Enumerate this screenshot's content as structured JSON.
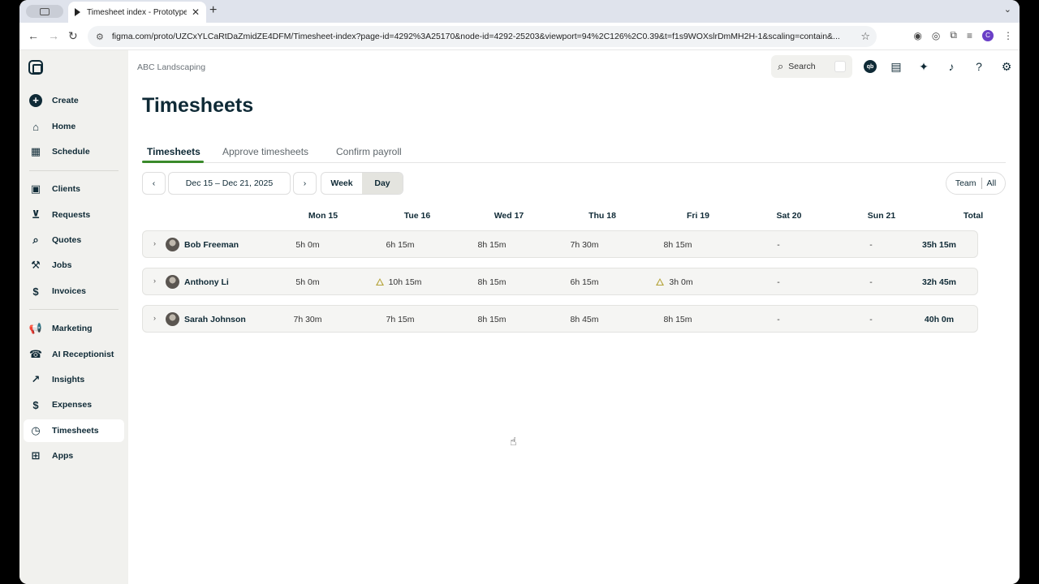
{
  "browser": {
    "tab_title": "Timesheet index - Prototype",
    "tab_close": "✕",
    "new_tab": "+",
    "url": "figma.com/proto/UZCxYLCaRtDaZmidZE4DFM/Timesheet-index?page-id=4292%3A25170&node-id=4292-25203&viewport=94%2C126%2C0.39&t=f1s9WOXslrDmMH2H-1&scaling=contain&...",
    "profile_initial": "C"
  },
  "sidebar": {
    "items": [
      {
        "label": "Create",
        "icon": "plus-circle-icon"
      },
      {
        "label": "Home",
        "icon": "home-icon"
      },
      {
        "label": "Schedule",
        "icon": "calendar-icon"
      },
      {
        "label": "Clients",
        "icon": "contacts-icon"
      },
      {
        "label": "Requests",
        "icon": "inbox-icon"
      },
      {
        "label": "Quotes",
        "icon": "quote-icon"
      },
      {
        "label": "Jobs",
        "icon": "hammer-icon"
      },
      {
        "label": "Invoices",
        "icon": "invoice-icon"
      },
      {
        "label": "Marketing",
        "icon": "megaphone-icon"
      },
      {
        "label": "AI Receptionist",
        "icon": "receptionist-icon"
      },
      {
        "label": "Insights",
        "icon": "chart-icon"
      },
      {
        "label": "Expenses",
        "icon": "expense-icon"
      },
      {
        "label": "Timesheets",
        "icon": "clock-icon"
      },
      {
        "label": "Apps",
        "icon": "apps-icon"
      }
    ],
    "active": "Timesheets"
  },
  "header": {
    "company": "ABC Landscaping",
    "search_label": "Search",
    "qb_label": "qb"
  },
  "page": {
    "title": "Timesheets",
    "tabs": [
      "Timesheets",
      "Approve timesheets",
      "Confirm payroll"
    ],
    "date_range": "Dec 15 – Dec 21, 2025",
    "view_week": "Week",
    "view_day": "Day",
    "team_label": "Team",
    "all_label": "All"
  },
  "table": {
    "columns": [
      "Mon 15",
      "Tue 16",
      "Wed 17",
      "Thu 18",
      "Fri 19",
      "Sat 20",
      "Sun 21",
      "Total"
    ],
    "rows": [
      {
        "name": "Bob Freeman",
        "cells": [
          "5h 0m",
          "6h 15m",
          "8h 15m",
          "7h 30m",
          "8h 15m",
          "-",
          "-",
          "35h 15m"
        ],
        "warnings": []
      },
      {
        "name": "Anthony Li",
        "cells": [
          "5h 0m",
          "10h 15m",
          "8h 15m",
          "6h 15m",
          "3h 0m",
          "-",
          "-",
          "32h 45m"
        ],
        "warnings": [
          1,
          4
        ]
      },
      {
        "name": "Sarah Johnson",
        "cells": [
          "7h 30m",
          "7h 15m",
          "8h 15m",
          "8h 45m",
          "8h 15m",
          "-",
          "-",
          "40h 0m"
        ],
        "warnings": []
      }
    ]
  },
  "colors": {
    "brand_dark": "#0f2a36",
    "tab_accent": "#3a8a2b",
    "warning": "#b5a43a"
  }
}
